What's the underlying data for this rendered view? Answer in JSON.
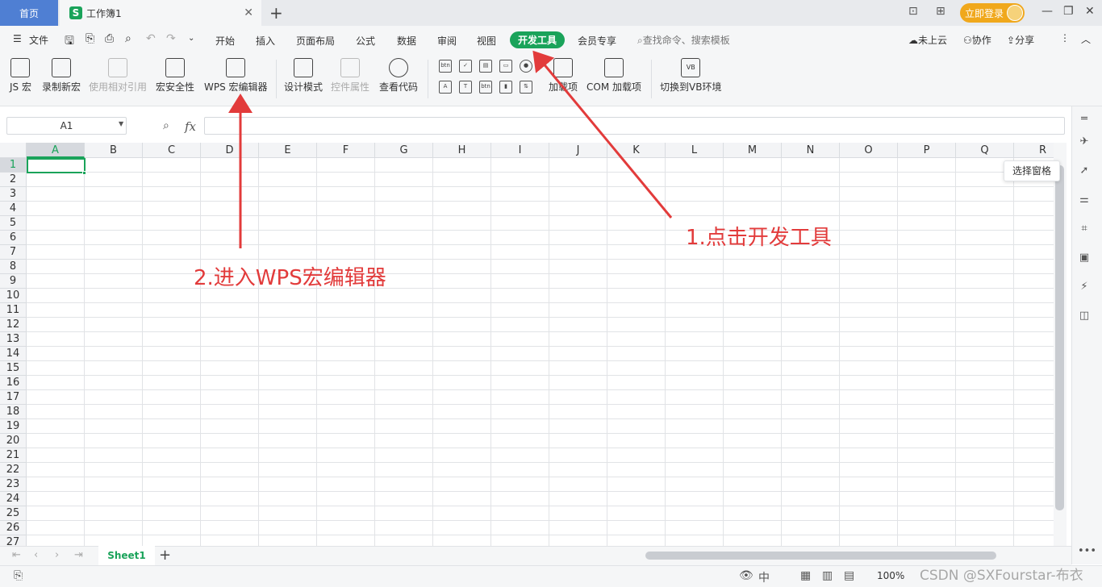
{
  "titlebar": {
    "home_tab": "首页",
    "doc_tab": "工作簿1",
    "doc_icon": "S",
    "login": "立即登录"
  },
  "menubar": {
    "file": "文件",
    "tabs": [
      "开始",
      "插入",
      "页面布局",
      "公式",
      "数据",
      "审阅",
      "视图"
    ],
    "active_tab": "开发工具",
    "tabs_after": [
      "会员专享"
    ],
    "search": "查找命令、搜索模板",
    "cloud": "未上云",
    "collab": "协作",
    "share": "分享"
  },
  "ribbon": {
    "js_macro": "JS 宏",
    "record_macro": "录制新宏",
    "relative_ref": "使用相对引用",
    "macro_security": "宏安全性",
    "wps_macro_editor": "WPS 宏编辑器",
    "design_mode": "设计模式",
    "control_props": "控件属性",
    "view_code": "查看代码",
    "addins": "加载项",
    "com_addins": "COM 加载项",
    "switch_vb": "切换到VB环境",
    "mini_btn": "btn",
    "mini_vb": "VB"
  },
  "formula": {
    "namebox": "A1",
    "fx": "fx",
    "value": ""
  },
  "grid": {
    "columns": [
      "A",
      "B",
      "C",
      "D",
      "E",
      "F",
      "G",
      "H",
      "I",
      "J",
      "K",
      "L",
      "M",
      "N",
      "O",
      "P",
      "Q",
      "R"
    ],
    "rows": [
      "1",
      "2",
      "3",
      "4",
      "5",
      "6",
      "7",
      "8",
      "9",
      "10",
      "11",
      "12",
      "13",
      "14",
      "15",
      "16",
      "17",
      "18",
      "19",
      "20",
      "21",
      "22",
      "23",
      "24",
      "25",
      "26",
      "27"
    ],
    "selected": "A1"
  },
  "sidebar": {
    "tooltip": "选择窗格"
  },
  "sheets": {
    "tabs": [
      "Sheet1"
    ]
  },
  "statusbar": {
    "zoom": "100%",
    "watermark": "CSDN @SXFourstar-布衣"
  },
  "annotations": {
    "step1": "1.点击开发工具",
    "step2": "2.进入WPS宏编辑器",
    "color": "#e23b3b"
  },
  "colors": {
    "accent": "#1aa35a",
    "home_tab": "#4f7fd3",
    "login": "#f0a81c"
  }
}
